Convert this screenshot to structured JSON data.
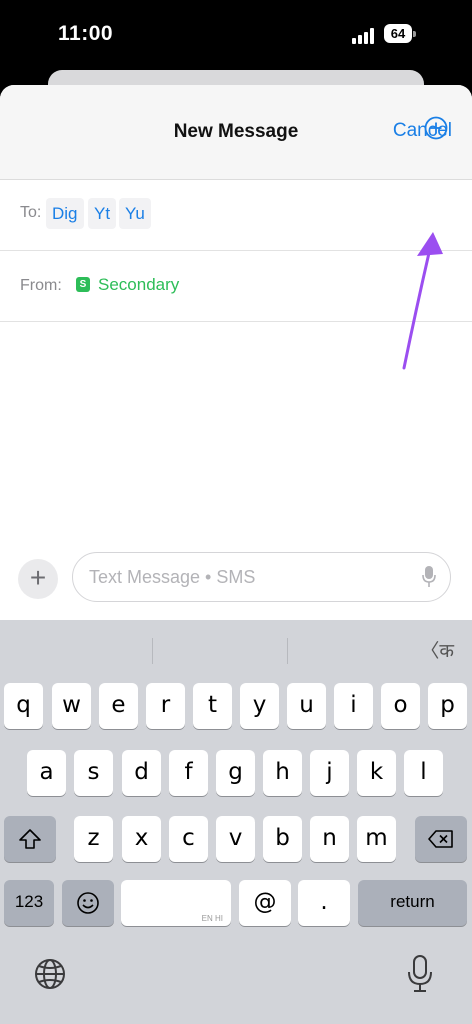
{
  "status_bar": {
    "time": "11:00",
    "battery": "64"
  },
  "header": {
    "title": "New Message",
    "cancel_label": "Cancel"
  },
  "recipients": {
    "label": "To:",
    "chips": [
      "Dig",
      "Yt",
      "Yu"
    ]
  },
  "sender": {
    "label": "From:",
    "sim_badge": "S",
    "sim_name": "Secondary"
  },
  "composer": {
    "placeholder": "Text Message • SMS",
    "plus_label": "+"
  },
  "keyboard": {
    "lang_switch": "〈क",
    "row1": [
      "q",
      "w",
      "e",
      "r",
      "t",
      "y",
      "u",
      "i",
      "o",
      "p"
    ],
    "row2": [
      "a",
      "s",
      "d",
      "f",
      "g",
      "h",
      "j",
      "k",
      "l"
    ],
    "row3": [
      "z",
      "x",
      "c",
      "v",
      "b",
      "n",
      "m"
    ],
    "numbers_label": "123",
    "at_label": "@",
    "period_label": ".",
    "return_label": "return",
    "space_hint": "EN HI"
  },
  "colors": {
    "accent_blue": "#1a7fe6",
    "sim_green": "#2dbd58",
    "annotation_arrow": "#9b4ef0"
  },
  "icons": [
    "add-contact-icon",
    "microphone-icon",
    "shift-icon",
    "delete-icon",
    "emoji-icon",
    "globe-icon",
    "dictation-icon"
  ]
}
